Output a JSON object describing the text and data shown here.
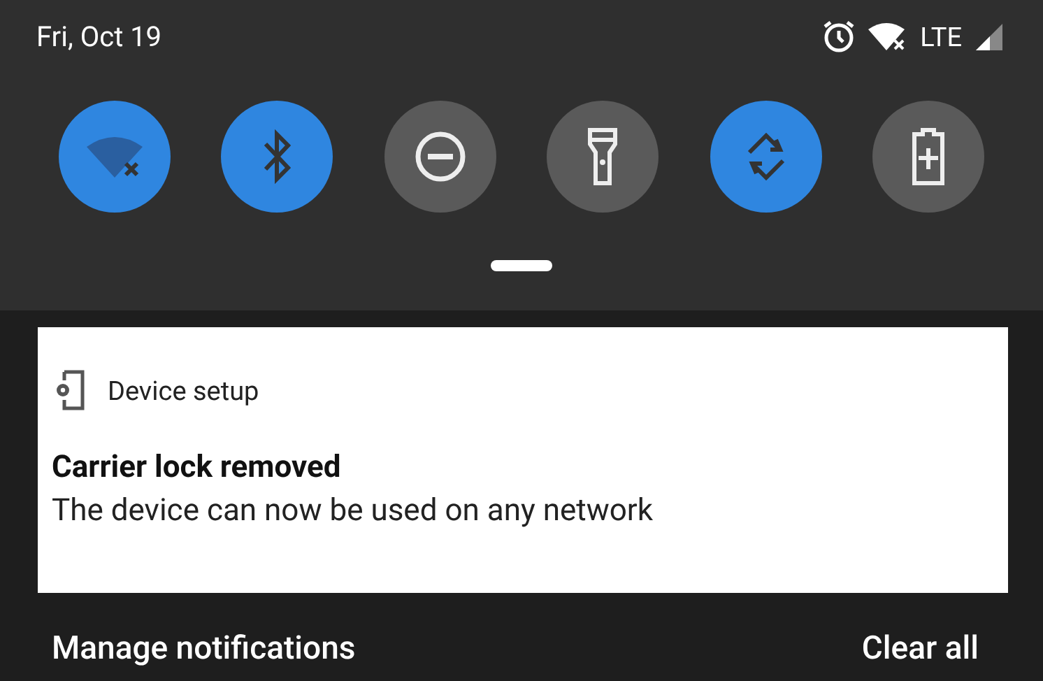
{
  "status_bar": {
    "date": "Fri, Oct 19",
    "network": "LTE"
  },
  "tiles": [
    {
      "kind": "wifi",
      "on": true
    },
    {
      "kind": "bluetooth",
      "on": true
    },
    {
      "kind": "dnd",
      "on": false
    },
    {
      "kind": "flashlight",
      "on": false
    },
    {
      "kind": "rotate",
      "on": true
    },
    {
      "kind": "battery",
      "on": false
    }
  ],
  "notification": {
    "app": "Device setup",
    "title": "Carrier lock removed",
    "text": "The device can now be used on any network"
  },
  "footer": {
    "manage": "Manage notifications",
    "clear": "Clear all"
  }
}
